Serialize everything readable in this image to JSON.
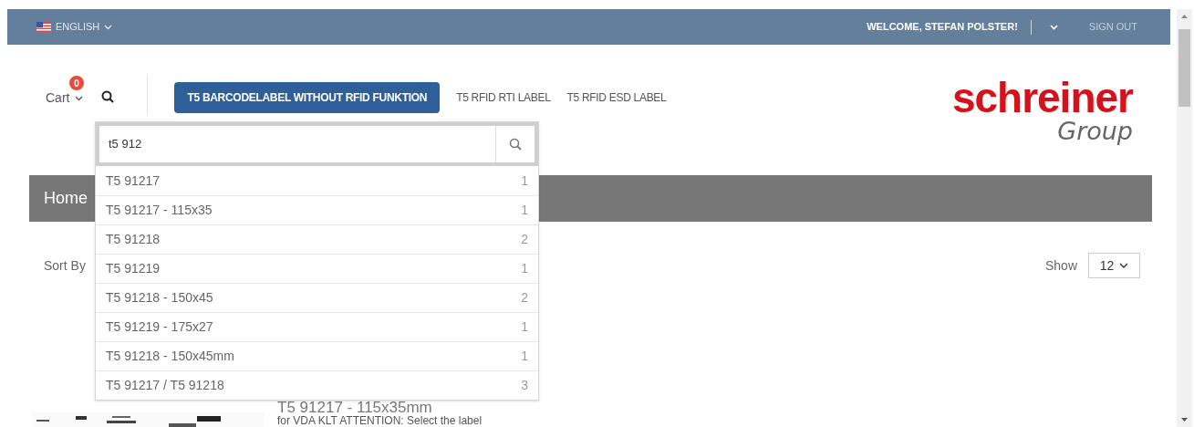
{
  "top_bar": {
    "language": "ENGLISH",
    "welcome": "WELCOME, STEFAN POLSTER!",
    "sign_out": "SIGN OUT"
  },
  "header": {
    "cart": {
      "label": "Cart",
      "count": "0"
    },
    "tabs": [
      {
        "label": "T5 BARCODELABEL WITHOUT RFID FUNKTION",
        "selected": true
      },
      {
        "label": "T5 RFID RTI LABEL",
        "selected": false
      },
      {
        "label": "T5 RFID ESD LABEL",
        "selected": false
      }
    ],
    "logo": {
      "name": "schreiner",
      "sub": "Group"
    }
  },
  "search": {
    "value": "t5 912",
    "suggestions": [
      {
        "text": "T5 91217",
        "count": "1"
      },
      {
        "text": "T5 91217 - 115x35",
        "count": "1"
      },
      {
        "text": "T5 91218",
        "count": "2"
      },
      {
        "text": "T5 91219",
        "count": "1"
      },
      {
        "text": "T5 91218 - 150x45",
        "count": "2"
      },
      {
        "text": "T5 91219 - 175x27",
        "count": "1"
      },
      {
        "text": "T5 91218 - 150x45mm",
        "count": "1"
      },
      {
        "text": "T5 91217 / T5 91218",
        "count": "3"
      }
    ]
  },
  "breadcrumb": [
    "Home"
  ],
  "toolbar": {
    "sort_label": "Sort By",
    "show_label": "Show",
    "show_value": "12"
  },
  "product": {
    "title": "T5 91217 - 115x35mm",
    "description": "for VDA KLT ATTENTION: Select the label"
  }
}
